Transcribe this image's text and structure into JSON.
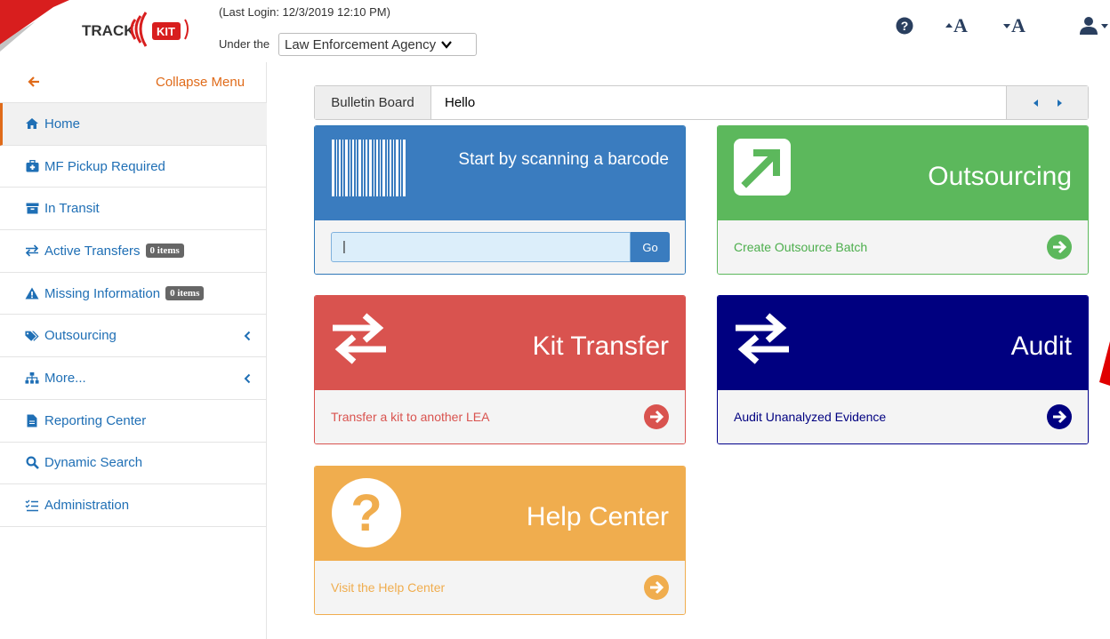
{
  "header": {
    "logo_text": "TRACK KIT",
    "last_login": "(Last Login: 12/3/2019 12:10 PM)",
    "under_label": "Under the",
    "agency_selected": "Law Enforcement Agency",
    "icons": [
      "question-circle-icon",
      "font-increase-icon",
      "font-decrease-icon",
      "user-menu-icon"
    ],
    "font_up_label": "A",
    "font_down_label": "A"
  },
  "sidebar": {
    "collapse_label": "Collapse Menu",
    "items": [
      {
        "label": "Home",
        "icon": "home-icon",
        "active": true
      },
      {
        "label": "MF Pickup Required",
        "icon": "medkit-icon"
      },
      {
        "label": "In Transit",
        "icon": "archive-icon"
      },
      {
        "label": "Active Transfers",
        "icon": "exchange-icon",
        "badge": "0 items"
      },
      {
        "label": "Missing Information",
        "icon": "warning-icon",
        "badge": "0 items"
      },
      {
        "label": "Outsourcing",
        "icon": "tags-icon",
        "expandable": true
      },
      {
        "label": "More...",
        "icon": "sitemap-icon",
        "expandable": true
      },
      {
        "label": "Reporting Center",
        "icon": "file-icon"
      },
      {
        "label": "Dynamic Search",
        "icon": "search-icon"
      },
      {
        "label": "Administration",
        "icon": "list-check-icon"
      }
    ]
  },
  "bulletin": {
    "label": "Bulletin Board",
    "message": "Hello"
  },
  "tiles": {
    "scan": {
      "title": "Start by scanning a barcode",
      "input_value": "|",
      "go_label": "Go",
      "color": "#3a7cbf"
    },
    "outsourcing": {
      "title": "Outsourcing",
      "footer": "Create Outsource Batch",
      "color": "#5cb85c"
    },
    "kit_transfer": {
      "title": "Kit Transfer",
      "footer": "Transfer a kit to another LEA",
      "color": "#d9534f"
    },
    "audit": {
      "title": "Audit",
      "footer": "Audit Unanalyzed Evidence",
      "color": "#000080"
    },
    "help": {
      "title": "Help Center",
      "footer": "Visit the Help Center",
      "color": "#f0ad4e"
    }
  },
  "colors": {
    "accent": "#e06b1a",
    "link": "#1f6fb5"
  }
}
